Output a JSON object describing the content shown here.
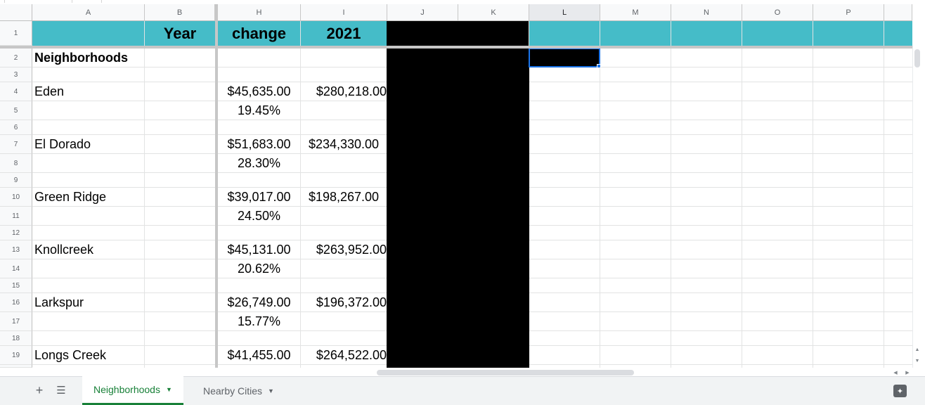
{
  "sheet": {
    "columns": [
      {
        "id": "col-a",
        "label": "A"
      },
      {
        "id": "col-b",
        "label": "B"
      },
      {
        "id": "col-h",
        "label": "H"
      },
      {
        "id": "col-i",
        "label": "I"
      },
      {
        "id": "col-j",
        "label": "J"
      },
      {
        "id": "col-k",
        "label": "K"
      },
      {
        "id": "col-l",
        "label": "L"
      },
      {
        "id": "col-m",
        "label": "M"
      },
      {
        "id": "col-n",
        "label": "N"
      },
      {
        "id": "col-o",
        "label": "O"
      },
      {
        "id": "col-p",
        "label": "P"
      }
    ],
    "rows": [
      "1",
      "2",
      "3",
      "4",
      "5",
      "6",
      "7",
      "8",
      "9",
      "10",
      "11",
      "12",
      "13",
      "14",
      "15",
      "16",
      "17",
      "18",
      "19"
    ],
    "selected_column": "L",
    "selected_cell": "L2",
    "header_fill_color": "#45bcc8",
    "redaction_color": "#000000",
    "header": {
      "b1": "Year",
      "h1": "change",
      "i1": "2021"
    },
    "title_cell": "Neighborhoods",
    "neighborhoods": [
      {
        "name": "Eden",
        "change": "$45,635.00",
        "pct": "19.45%",
        "value_2021": "$280,218.00"
      },
      {
        "name": "El Dorado",
        "change": "$51,683.00",
        "pct": "28.30%",
        "value_2021": "$234,330.00"
      },
      {
        "name": "Green Ridge",
        "change": "$39,017.00",
        "pct": "24.50%",
        "value_2021": "$198,267.00"
      },
      {
        "name": "Knollcreek",
        "change": "$45,131.00",
        "pct": "20.62%",
        "value_2021": "$263,952.00"
      },
      {
        "name": "Larkspur",
        "change": "$26,749.00",
        "pct": "15.77%",
        "value_2021": "$196,372.00"
      },
      {
        "name": "Longs Creek",
        "change": "$41,455.00",
        "pct": null,
        "value_2021": "$264,522.00"
      }
    ]
  },
  "tabs": {
    "add_icon": "plus-icon",
    "list_icon": "menu-lines-icon",
    "items": [
      {
        "label": "Neighborhoods",
        "active": true
      },
      {
        "label": "Nearby Cities",
        "active": false
      }
    ],
    "explore_icon": "explore-sparkle-icon"
  }
}
